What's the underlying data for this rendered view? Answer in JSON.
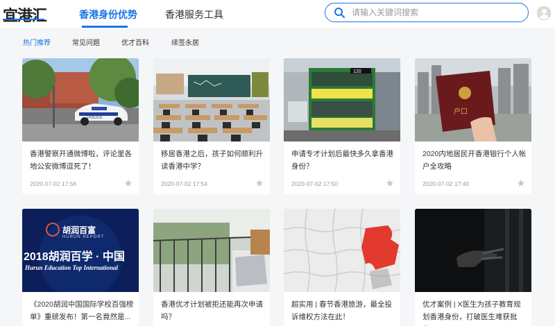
{
  "header": {
    "logo_text": "宜港汇",
    "nav": [
      {
        "label": "香港身份优势",
        "active": true
      },
      {
        "label": "香港服务工具",
        "active": false
      }
    ],
    "search_placeholder": "请输入关键词搜索",
    "accent_color": "#1a73e8"
  },
  "subnav": {
    "tabs": [
      {
        "label": "热门推荐",
        "active": true
      },
      {
        "label": "常见问题",
        "active": false
      },
      {
        "label": "优才百科",
        "active": false
      },
      {
        "label": "续签永居",
        "active": false
      }
    ]
  },
  "articles": [
    {
      "title": "香港警察开通微博啦，评论里各地公安微博逗死了！",
      "date": "2020-07-02 17:56",
      "image": "police-car"
    },
    {
      "title": "移居香港之后，孩子如何顺利升读香港中学？",
      "date": "2020-07-02 17:54",
      "image": "classroom"
    },
    {
      "title": "申请专才计划后最快多久拿香港身份？",
      "date": "2020-07-02 17:50",
      "image": "tram"
    },
    {
      "title": "2020内地居民开香港银行个人帐户全攻略",
      "date": "2020-07-02 17:40",
      "image": "household-register"
    },
    {
      "title": "《2020胡润中国国际学校百强榜单》重磅发布！第一名竟然是...",
      "date": "",
      "image": "hurun-banner",
      "banner": {
        "brand": "胡润百富",
        "brand_en": "HURUN REPORT",
        "headline": "2018胡润百学 · 中国",
        "subline": "Hurun Education Top International"
      }
    },
    {
      "title": "香港优才计划被拒还能再次申请吗？",
      "date": "",
      "image": "laptop-balcony"
    },
    {
      "title": "超实用 | 春节香港旅游，最全投诉维权方法在此！",
      "date": "",
      "image": "puzzle"
    },
    {
      "title": "优才案例 | X医生为孩子教育规划香港身份，打破医生难获批传...",
      "date": "",
      "image": "dark-hand"
    }
  ]
}
